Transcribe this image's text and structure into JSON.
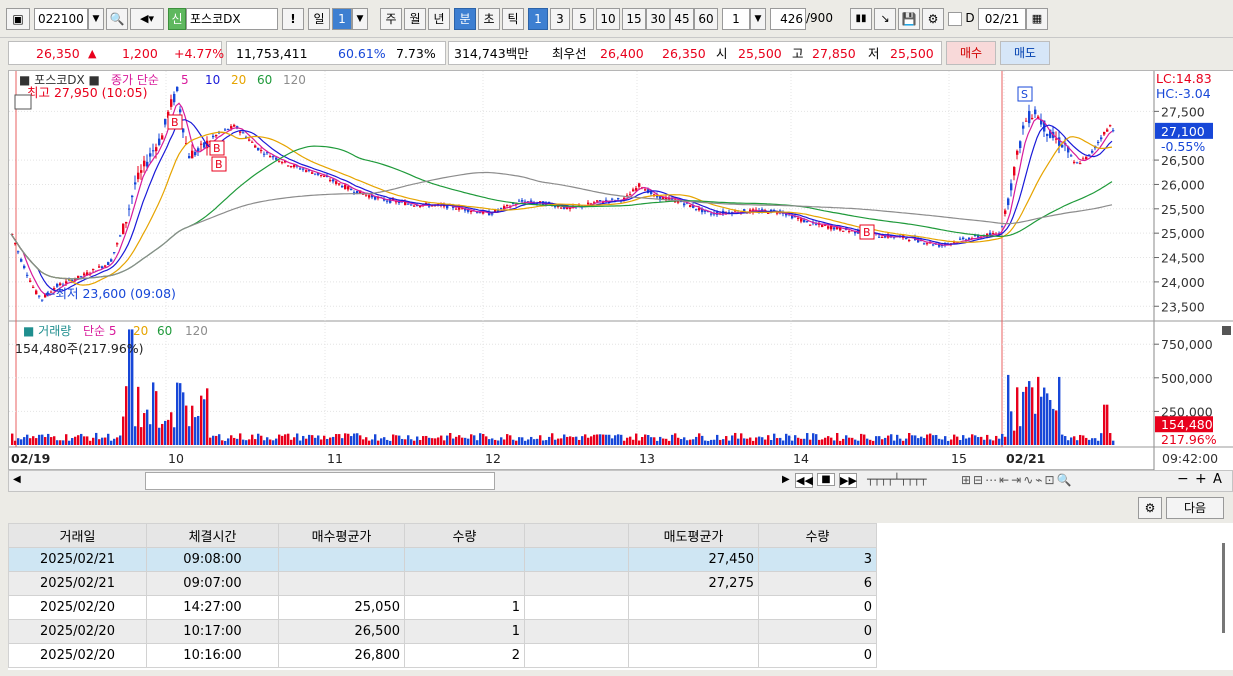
{
  "toolbar": {
    "code": "022100",
    "market_badge": "신",
    "name": "포스코DX",
    "exclaim": "!",
    "periods": [
      "일",
      "1",
      "주",
      "월",
      "년",
      "분",
      "초",
      "틱"
    ],
    "intervals": [
      "1",
      "3",
      "5",
      "10",
      "15",
      "30",
      "45",
      "60"
    ],
    "interval_value": "1",
    "count": "426",
    "count_total": "/900",
    "date_label": "D",
    "date": "02/21"
  },
  "quote": {
    "price": "26,350",
    "arrow": "▲",
    "change": "1,200",
    "change_pct": "+4.77%",
    "volume": "11,753,411",
    "vol_ratio": "60.61%",
    "turnover": "7.73%",
    "amount": "314,743백만",
    "best_label": "최우선",
    "best_ask": "26,400",
    "best_bid": "26,350",
    "open_label": "시",
    "open": "25,500",
    "high_label": "고",
    "high": "27,850",
    "low_label": "저",
    "low": "25,500",
    "buy_button": "매수",
    "sell_button": "매도"
  },
  "chart": {
    "price_legend": {
      "name": "포스코DX",
      "ma_label": "종가 단순",
      "ma": [
        "5",
        "10",
        "20",
        "60",
        "120"
      ]
    },
    "high_note": "최고 27,950 (10:05)",
    "low_note": "최저 23,600 (09:08)",
    "lc_label": "LC:14.83",
    "hc_label": "HC:-3.04",
    "current_price_tag": "27,100",
    "current_pct": "-0.55%",
    "price_ticks": [
      "27,500",
      "26,500",
      "26,000",
      "25,500",
      "25,000",
      "24,500",
      "24,000",
      "23,500"
    ],
    "vol_legend": {
      "name": "거래량",
      "ma_label": "단순",
      "ma": [
        "5",
        "20",
        "60",
        "120"
      ]
    },
    "vol_note": "154,480주(217.96%)",
    "vol_ticks": [
      "750,000",
      "500,000",
      "250,000"
    ],
    "vol_tag": "154,480",
    "vol_pct": "217.96%",
    "x_labels": [
      "02/19",
      "10",
      "11",
      "12",
      "13",
      "14",
      "15",
      "02/21"
    ],
    "time": "09:42:00",
    "markers": [
      "B",
      "B",
      "B",
      "B",
      "S"
    ]
  },
  "chart_data": {
    "type": "candlestick",
    "ylim": [
      23300,
      28000
    ],
    "x": [
      "02/19 09:00",
      "10",
      "11",
      "12",
      "13",
      "14",
      "15",
      "02/21 09:00",
      "09:42"
    ],
    "close": [
      25000,
      26900,
      25700,
      25400,
      25600,
      25550,
      24900,
      26300,
      27100
    ],
    "high": 27950,
    "low": 23600
  },
  "table": {
    "headers": [
      "거래일",
      "체결시간",
      "매수평균가",
      "수량",
      "",
      "매도평균가",
      "수량"
    ],
    "rows": [
      [
        "2025/02/21",
        "09:08:00",
        "",
        "",
        "",
        "27,450",
        "3"
      ],
      [
        "2025/02/21",
        "09:07:00",
        "",
        "",
        "",
        "27,275",
        "6"
      ],
      [
        "2025/02/20",
        "14:27:00",
        "25,050",
        "1",
        "",
        "",
        "0"
      ],
      [
        "2025/02/20",
        "10:17:00",
        "26,500",
        "1",
        "",
        "",
        "0"
      ],
      [
        "2025/02/20",
        "10:16:00",
        "26,800",
        "2",
        "",
        "",
        "0"
      ]
    ],
    "next_button": "다음"
  },
  "colors": {
    "up": "#e8001c",
    "down": "#1747d8",
    "ma5": "#d81b9b",
    "ma10": "#1a1ad8",
    "ma20": "#e6a400",
    "ma60": "#1f9a3a",
    "ma120": "#8c8c8c"
  }
}
